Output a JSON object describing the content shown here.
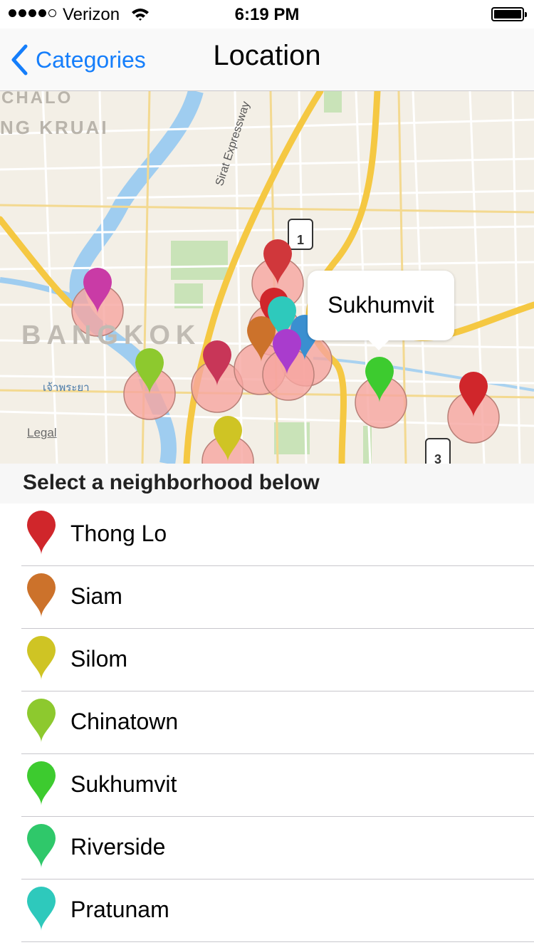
{
  "status_bar": {
    "carrier": "Verizon",
    "time": "6:19 PM"
  },
  "nav": {
    "back_label": "Categories",
    "title": "Location"
  },
  "map": {
    "labels": {
      "chalo": "CHALO",
      "ng_kruai": "NG KRUAI",
      "bangkok": "BANGKOK",
      "expressway": "Sirat Expressway",
      "thai_river": "เจ้าพระยา",
      "route_1": "1",
      "route_3": "3"
    },
    "legal": "Legal",
    "callout": "Sukhumvit"
  },
  "section_header": "Select a neighborhood below",
  "neighborhoods": [
    {
      "name": "Thong Lo",
      "color": "#d0262b"
    },
    {
      "name": "Siam",
      "color": "#cc722b"
    },
    {
      "name": "Silom",
      "color": "#cfc424"
    },
    {
      "name": "Chinatown",
      "color": "#8dc92e"
    },
    {
      "name": "Sukhumvit",
      "color": "#3dcb2f"
    },
    {
      "name": "Riverside",
      "color": "#2fc86a"
    },
    {
      "name": "Pratunam",
      "color": "#2ec9bc"
    }
  ],
  "colors": {
    "accent": "#157efb",
    "pin_halo": "#f6a5a0"
  }
}
